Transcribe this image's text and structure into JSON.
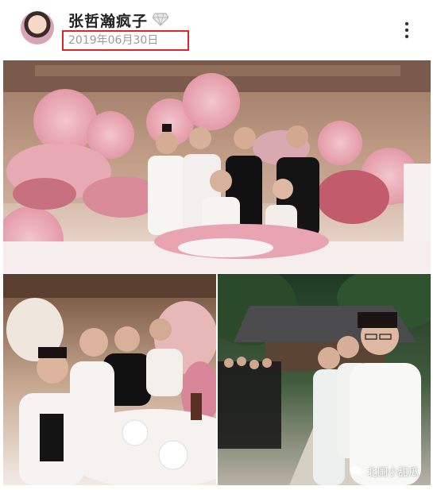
{
  "post": {
    "username": "张哲瀚疯子",
    "date": "2019年06月30日"
  },
  "icons": {
    "avatar": "avatar",
    "badge": "diamond-vip-icon",
    "more": "more-vertical-icon",
    "watermark_logo": "wechat-channel-icon"
  },
  "watermark": {
    "text": "北国小甜瓜"
  },
  "colors": {
    "date_highlight_border": "#e0242b",
    "date_text": "#9a9a9a",
    "username_text": "#222222"
  }
}
